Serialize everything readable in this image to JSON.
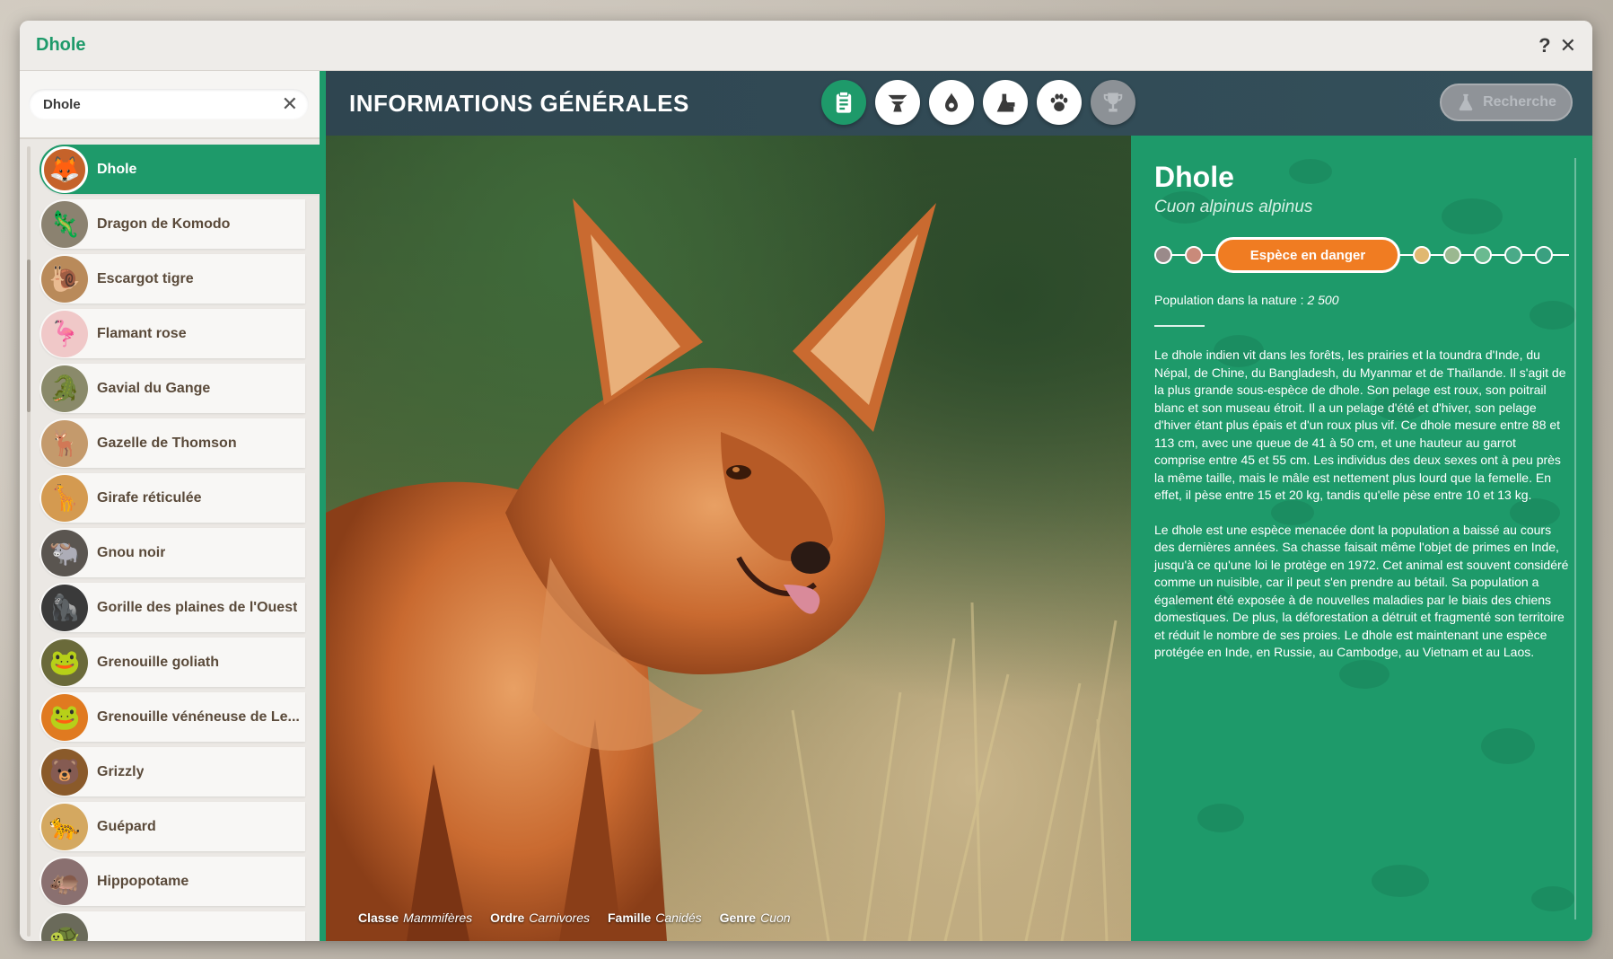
{
  "window": {
    "title": "Dhole",
    "help_label": "?",
    "close_label": "✕"
  },
  "search": {
    "value": "Dhole",
    "clear_label": "✕"
  },
  "animals": [
    {
      "name": "Dhole",
      "icon": "🦊",
      "bg": "#c5622a",
      "selected": true
    },
    {
      "name": "Dragon de Komodo",
      "icon": "🦎",
      "bg": "#8b8270"
    },
    {
      "name": "Escargot tigre",
      "icon": "🐌",
      "bg": "#b98a5a"
    },
    {
      "name": "Flamant rose",
      "icon": "🦩",
      "bg": "#f0c8c8"
    },
    {
      "name": "Gavial du Gange",
      "icon": "🐊",
      "bg": "#8a8a6a"
    },
    {
      "name": "Gazelle de Thomson",
      "icon": "🦌",
      "bg": "#c49a6c"
    },
    {
      "name": "Girafe réticulée",
      "icon": "🦒",
      "bg": "#d49a50"
    },
    {
      "name": "Gnou noir",
      "icon": "🐃",
      "bg": "#5a5550"
    },
    {
      "name": "Gorille des plaines de l'Ouest",
      "icon": "🦍",
      "bg": "#3a3a3a"
    },
    {
      "name": "Grenouille goliath",
      "icon": "🐸",
      "bg": "#6a6a3a"
    },
    {
      "name": "Grenouille vénéneuse de Le...",
      "icon": "🐸",
      "bg": "#e07a20"
    },
    {
      "name": "Grizzly",
      "icon": "🐻",
      "bg": "#8a5a2a"
    },
    {
      "name": "Guépard",
      "icon": "🐆",
      "bg": "#d4a860"
    },
    {
      "name": "Hippopotame",
      "icon": "🦛",
      "bg": "#8a7070"
    },
    {
      "name": "",
      "icon": "🐢",
      "bg": "#6a6a5a"
    }
  ],
  "header": {
    "section_title": "INFORMATIONS GÉNÉRALES",
    "research_label": "Recherche"
  },
  "tabs": [
    {
      "name": "clipboard-icon",
      "state": "active"
    },
    {
      "name": "habitat-icon",
      "state": "normal"
    },
    {
      "name": "food-icon",
      "state": "normal"
    },
    {
      "name": "enrichment-icon",
      "state": "normal"
    },
    {
      "name": "paw-icon",
      "state": "normal"
    },
    {
      "name": "trophy-icon",
      "state": "disabled"
    }
  ],
  "taxonomy": {
    "class_label": "Classe",
    "class_value": "Mammifères",
    "order_label": "Ordre",
    "order_value": "Carnivores",
    "family_label": "Famille",
    "family_value": "Canidés",
    "genus_label": "Genre",
    "genus_value": "Cuon"
  },
  "info": {
    "name": "Dhole",
    "latin": "Cuon alpinus alpinus",
    "status_label": "Espèce en danger",
    "status_dots_left": [
      "#9a8a8a",
      "#c98a7a"
    ],
    "status_dots_right": [
      "#e0b870",
      "#9ab890",
      "#6aba90",
      "#4aaa88",
      "#3aa080"
    ],
    "population_label": "Population dans la nature :",
    "population_value": "2 500",
    "paragraph1": "Le dhole indien vit dans les forêts, les prairies et la toundra d'Inde, du Népal, de Chine, du Bangladesh, du Myanmar et de Thaïlande. Il s'agit de la plus grande sous-espèce de dhole. Son pelage est roux, son poitrail blanc et son museau étroit. Il a un pelage d'été et d'hiver, son pelage d'hiver étant plus épais et d'un roux plus vif. Ce dhole mesure entre 88 et 113 cm, avec une queue de 41 à 50 cm, et une hauteur au garrot comprise entre 45 et 55 cm. Les individus des deux sexes ont à peu près la même taille, mais le mâle est nettement plus lourd que la femelle. En effet, il pèse entre 15 et 20 kg, tandis qu'elle pèse entre 10 et 13 kg.",
    "paragraph2": "Le dhole est une espèce menacée dont la population a baissé au cours des dernières années. Sa chasse faisait même l'objet de primes en Inde, jusqu'à ce qu'une loi le protège en 1972. Cet animal est souvent considéré comme un nuisible, car il peut s'en prendre au bétail. Sa population a également été exposée à de nouvelles maladies par le biais des chiens domestiques. De plus, la déforestation a détruit et fragmenté son territoire et réduit le nombre de ses proies. Le dhole est maintenant une espèce protégée en Inde, en Russie, au Cambodge, au Vietnam et au Laos."
  },
  "colors": {
    "accent": "#1e9a6a",
    "danger": "#f07c22",
    "header": "#2f4550"
  }
}
